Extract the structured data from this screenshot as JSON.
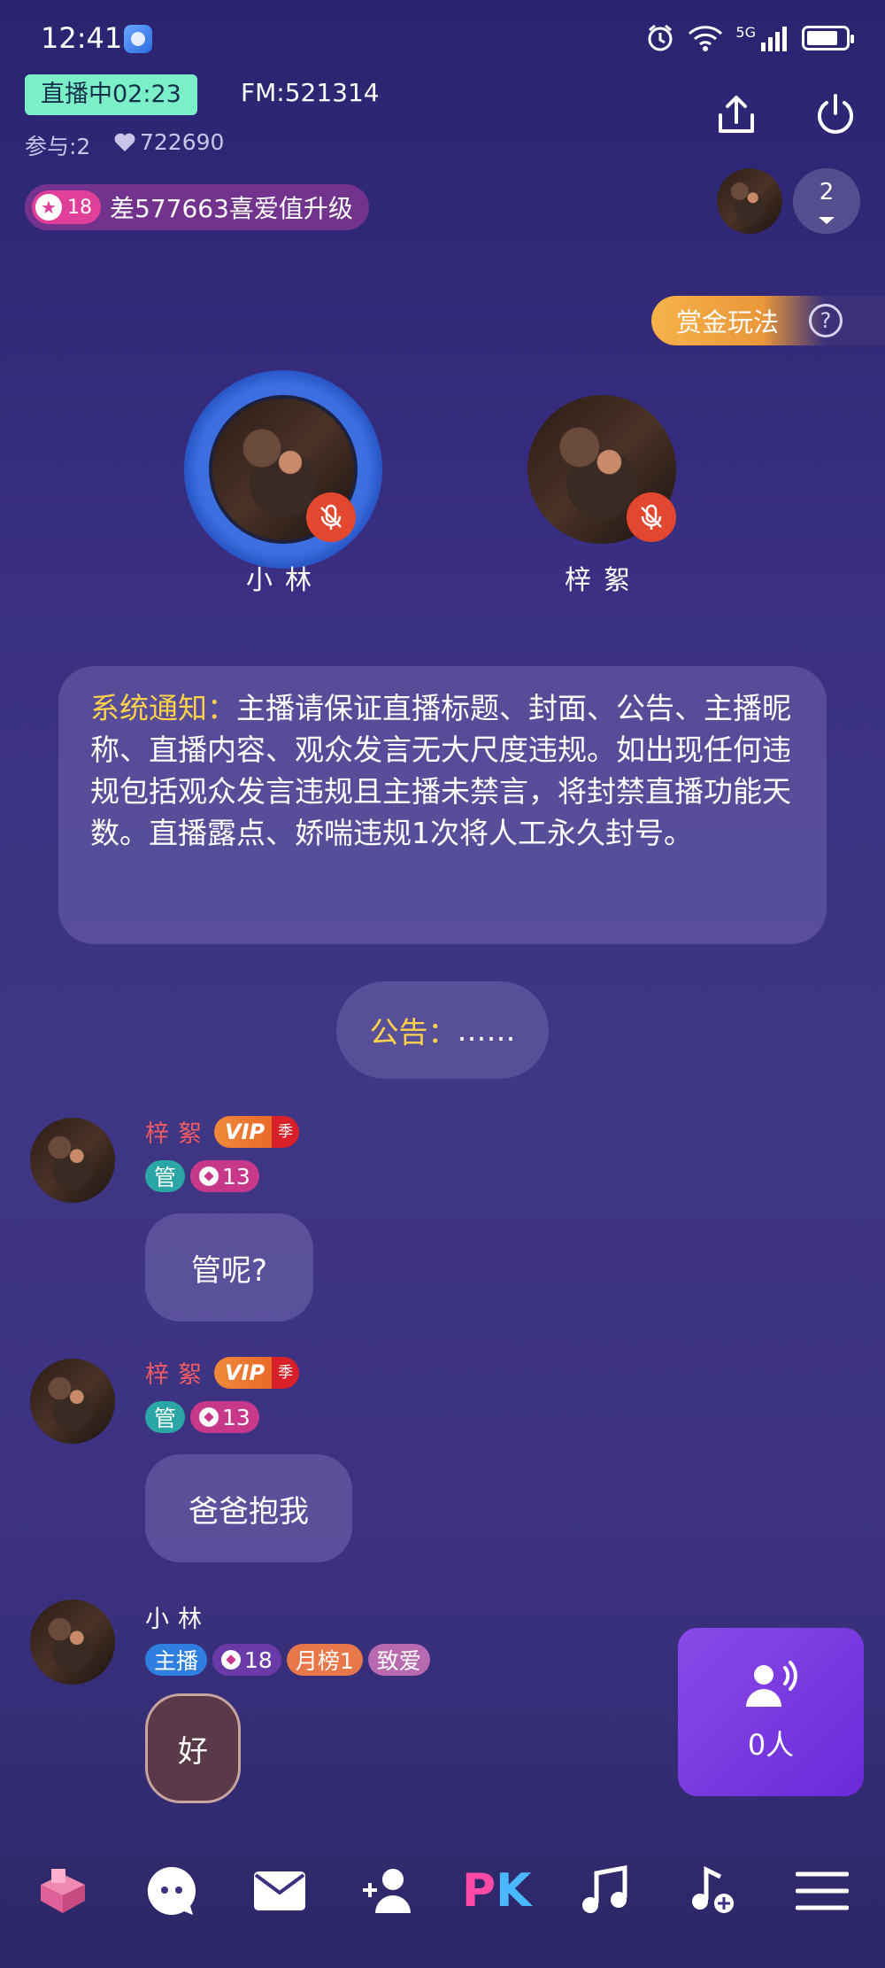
{
  "status_bar": {
    "time": "12:41",
    "network": "5G"
  },
  "room": {
    "live_label": "直播中02:23",
    "fm": "FM:521314",
    "participants": "参与:2",
    "likes": "722690",
    "level": "18",
    "upgrade_text": "差577663喜爱值升级",
    "viewer_count": "2",
    "bounty_label": "赏金玩法",
    "bounty_help": "?"
  },
  "seats": [
    {
      "name": "小林",
      "muted": true,
      "speaking": true
    },
    {
      "name": "梓絮",
      "muted": true,
      "speaking": false
    }
  ],
  "notice": {
    "label": "系统通知：",
    "text": "主播请保证直播标题、封面、公告、主播昵称、直播内容、观众发言无大尺度违规。如出现任何违规包括观众发言违规且主播未禁言，将封禁直播功能天数。直播露点、娇喘违规1次将人工永久封号。"
  },
  "announcement": {
    "label": "公告：",
    "text": "……"
  },
  "messages": [
    {
      "name": "梓絮",
      "vip": "VIP",
      "vip_season": "季",
      "tags": [
        "管"
      ],
      "level": "13",
      "text": "管呢?"
    },
    {
      "name": "梓絮",
      "vip": "VIP",
      "vip_season": "季",
      "tags": [
        "管"
      ],
      "level": "13",
      "text": "爸爸抱我"
    },
    {
      "name": "小林",
      "tags": [
        "主播"
      ],
      "level": "18",
      "rank": "月榜1",
      "title": "致爱",
      "text": "好"
    }
  ],
  "mic_queue": {
    "count": "0人"
  },
  "bottom_bar": [
    "gift-box-icon",
    "chat-icon",
    "mail-icon",
    "add-friend-icon",
    "pk-icon",
    "music-icon",
    "song-request-icon",
    "menu-icon"
  ],
  "pk_label": {
    "p": "P",
    "k": "K"
  },
  "colors": {
    "accent_yellow": "#ffd24a",
    "live_green": "#7bf0c8",
    "mic_off_red": "#e3472f",
    "queue_purple": "#7a3ae0"
  }
}
